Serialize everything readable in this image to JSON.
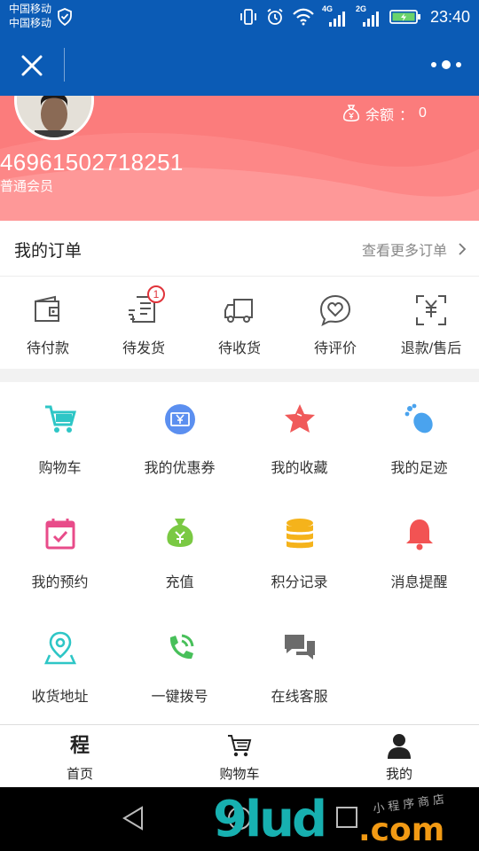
{
  "status_bar": {
    "carrier_1": "中国移动",
    "carrier_2": "中国移动",
    "net_1": "4G",
    "net_2": "2G",
    "time": "23:40"
  },
  "profile": {
    "user_id": "46961502718251",
    "member_level": "普通会员",
    "balance_label": "余额",
    "balance_value": "0"
  },
  "orders": {
    "title": "我的订单",
    "more_label": "查看更多订单",
    "items": [
      {
        "label": "待付款",
        "icon": "wallet-icon"
      },
      {
        "label": "待发货",
        "icon": "receipt-icon",
        "badge": "1"
      },
      {
        "label": "待收货",
        "icon": "truck-icon"
      },
      {
        "label": "待评价",
        "icon": "heart-chat-icon"
      },
      {
        "label": "退款/售后",
        "icon": "refund-icon"
      }
    ]
  },
  "services": {
    "items": [
      {
        "label": "购物车",
        "icon": "cart-icon",
        "color": "#2ec6c6"
      },
      {
        "label": "我的优惠券",
        "icon": "coupon-icon",
        "color": "#5b8ff0"
      },
      {
        "label": "我的收藏",
        "icon": "star-icon",
        "color": "#f05a5a"
      },
      {
        "label": "我的足迹",
        "icon": "footprint-icon",
        "color": "#4aa3ee"
      },
      {
        "label": "我的预约",
        "icon": "calendar-icon",
        "color": "#e84c8a"
      },
      {
        "label": "充值",
        "icon": "money-bag-icon",
        "color": "#7ac943"
      },
      {
        "label": "积分记录",
        "icon": "coins-icon",
        "color": "#f5b31b"
      },
      {
        "label": "消息提醒",
        "icon": "bell-icon",
        "color": "#f25353"
      },
      {
        "label": "收货地址",
        "icon": "location-icon",
        "color": "#2ec6c6"
      },
      {
        "label": "一键拨号",
        "icon": "phone-icon",
        "color": "#48c05a"
      },
      {
        "label": "在线客服",
        "icon": "chat-icon",
        "color": "#6b6b6b"
      }
    ]
  },
  "tabbar": {
    "home_glyph": "程",
    "items": [
      {
        "label": "首页",
        "icon": "home-icon"
      },
      {
        "label": "购物车",
        "icon": "cart-icon"
      },
      {
        "label": "我的",
        "icon": "user-icon"
      }
    ]
  },
  "watermark": {
    "main": "9lud",
    "suffix": ".com",
    "sub": "小程序商店"
  },
  "colors": {
    "header_blue": "#0b5bb5",
    "profile_red": "#fb7c7c",
    "badge_red": "#e0333a"
  }
}
